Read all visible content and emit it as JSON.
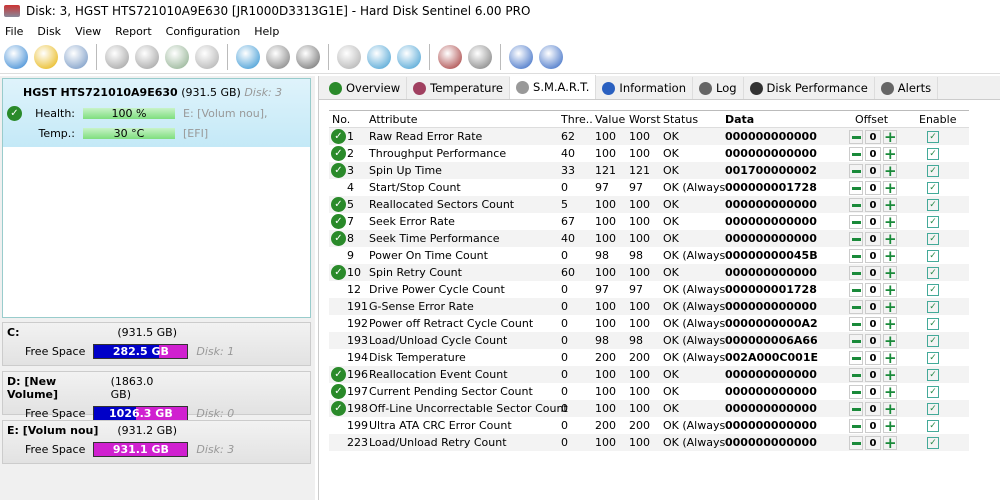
{
  "window": {
    "title": "Disk: 3, HGST HTS721010A9E630 [JR1000D3313G1E]  -  Hard Disk Sentinel 6.00 PRO"
  },
  "menu": [
    "File",
    "Disk",
    "View",
    "Report",
    "Configuration",
    "Help"
  ],
  "toolbar_icons": [
    "refresh-icon",
    "alert-icon",
    "disk-icon",
    "disk-info-icon",
    "disk-timer-icon",
    "disk-check-icon",
    "disk-search-icon",
    "globe-icon",
    "drive-icon",
    "printer-icon",
    "report-icon",
    "sync-icon",
    "network-icon",
    "monitor-icon",
    "speaker-icon",
    "help-icon",
    "info-icon"
  ],
  "disk": {
    "name": "HGST HTS721010A9E630",
    "size": "(931.5 GB)",
    "disk_label": "Disk: 3",
    "health_label": "Health:",
    "health_value": "100 %",
    "health_percent": 100,
    "temp_label": "Temp.:",
    "temp_value": "30 °C",
    "partition": "E: [Volum nou],",
    "efi": "[EFI]"
  },
  "volumes": [
    {
      "name": "C:",
      "size": "(931.5 GB)",
      "free_label": "Free Space",
      "free": "282.5 GB",
      "disk": "Disk: 1",
      "free_fraction": 0.3
    },
    {
      "name": "D: [New Volume]",
      "size": "(1863.0 GB)",
      "free_label": "Free Space",
      "free": "1026.3 GB",
      "disk": "Disk: 0",
      "free_fraction": 0.55
    },
    {
      "name": "E: [Volum nou]",
      "size": "(931.2 GB)",
      "free_label": "Free Space",
      "free": "931.1 GB",
      "disk": "Disk: 3",
      "free_fraction": 1.0
    }
  ],
  "tabs": [
    {
      "label": "Overview",
      "icon": "check-icon"
    },
    {
      "label": "Temperature",
      "icon": "thermometer-icon"
    },
    {
      "label": "S.M.A.R.T.",
      "icon": "smart-icon",
      "active": true
    },
    {
      "label": "Information",
      "icon": "info-icon"
    },
    {
      "label": "Log",
      "icon": "log-icon"
    },
    {
      "label": "Disk Performance",
      "icon": "performance-icon"
    },
    {
      "label": "Alerts",
      "icon": "alerts-icon"
    }
  ],
  "smart": {
    "headers": [
      "No.",
      "Attribute",
      "Thre...",
      "Value",
      "Worst",
      "Status",
      "Data",
      "Offset",
      "Enable"
    ],
    "rows": [
      {
        "no": "1",
        "attr": "Raw Read Error Rate",
        "thr": "62",
        "val": "100",
        "worst": "100",
        "status": "OK",
        "data": "000000000000",
        "offset": "0",
        "ok_icon": true
      },
      {
        "no": "2",
        "attr": "Throughput Performance",
        "thr": "40",
        "val": "100",
        "worst": "100",
        "status": "OK",
        "data": "000000000000",
        "offset": "0",
        "ok_icon": true
      },
      {
        "no": "3",
        "attr": "Spin Up Time",
        "thr": "33",
        "val": "121",
        "worst": "121",
        "status": "OK",
        "data": "001700000002",
        "offset": "0",
        "ok_icon": true
      },
      {
        "no": "4",
        "attr": "Start/Stop Count",
        "thr": "0",
        "val": "97",
        "worst": "97",
        "status": "OK (Always...",
        "data": "000000001728",
        "offset": "0",
        "ok_icon": false
      },
      {
        "no": "5",
        "attr": "Reallocated Sectors Count",
        "thr": "5",
        "val": "100",
        "worst": "100",
        "status": "OK",
        "data": "000000000000",
        "offset": "0",
        "ok_icon": true
      },
      {
        "no": "7",
        "attr": "Seek Error Rate",
        "thr": "67",
        "val": "100",
        "worst": "100",
        "status": "OK",
        "data": "000000000000",
        "offset": "0",
        "ok_icon": true
      },
      {
        "no": "8",
        "attr": "Seek Time Performance",
        "thr": "40",
        "val": "100",
        "worst": "100",
        "status": "OK",
        "data": "000000000000",
        "offset": "0",
        "ok_icon": true
      },
      {
        "no": "9",
        "attr": "Power On Time Count",
        "thr": "0",
        "val": "98",
        "worst": "98",
        "status": "OK (Always...",
        "data": "00000000045B",
        "offset": "0",
        "ok_icon": false
      },
      {
        "no": "10",
        "attr": "Spin Retry Count",
        "thr": "60",
        "val": "100",
        "worst": "100",
        "status": "OK",
        "data": "000000000000",
        "offset": "0",
        "ok_icon": true
      },
      {
        "no": "12",
        "attr": "Drive Power Cycle Count",
        "thr": "0",
        "val": "97",
        "worst": "97",
        "status": "OK (Always...",
        "data": "000000001728",
        "offset": "0",
        "ok_icon": false
      },
      {
        "no": "191",
        "attr": "G-Sense Error Rate",
        "thr": "0",
        "val": "100",
        "worst": "100",
        "status": "OK (Always...",
        "data": "000000000000",
        "offset": "0",
        "ok_icon": false
      },
      {
        "no": "192",
        "attr": "Power off Retract Cycle Count",
        "thr": "0",
        "val": "100",
        "worst": "100",
        "status": "OK (Always...",
        "data": "0000000000A2",
        "offset": "0",
        "ok_icon": false
      },
      {
        "no": "193",
        "attr": "Load/Unload Cycle Count",
        "thr": "0",
        "val": "98",
        "worst": "98",
        "status": "OK (Always...",
        "data": "000000006A66",
        "offset": "0",
        "ok_icon": false
      },
      {
        "no": "194",
        "attr": "Disk Temperature",
        "thr": "0",
        "val": "200",
        "worst": "200",
        "status": "OK (Always...",
        "data": "002A000C001E",
        "offset": "0",
        "ok_icon": false
      },
      {
        "no": "196",
        "attr": "Reallocation Event Count",
        "thr": "0",
        "val": "100",
        "worst": "100",
        "status": "OK",
        "data": "000000000000",
        "offset": "0",
        "ok_icon": true
      },
      {
        "no": "197",
        "attr": "Current Pending Sector Count",
        "thr": "0",
        "val": "100",
        "worst": "100",
        "status": "OK",
        "data": "000000000000",
        "offset": "0",
        "ok_icon": true
      },
      {
        "no": "198",
        "attr": "Off-Line Uncorrectable Sector Count",
        "thr": "0",
        "val": "100",
        "worst": "100",
        "status": "OK",
        "data": "000000000000",
        "offset": "0",
        "ok_icon": true
      },
      {
        "no": "199",
        "attr": "Ultra ATA CRC Error Count",
        "thr": "0",
        "val": "200",
        "worst": "200",
        "status": "OK (Always...",
        "data": "000000000000",
        "offset": "0",
        "ok_icon": false
      },
      {
        "no": "223",
        "attr": "Load/Unload Retry Count",
        "thr": "0",
        "val": "100",
        "worst": "100",
        "status": "OK (Always...",
        "data": "000000000000",
        "offset": "0",
        "ok_icon": false
      }
    ]
  }
}
